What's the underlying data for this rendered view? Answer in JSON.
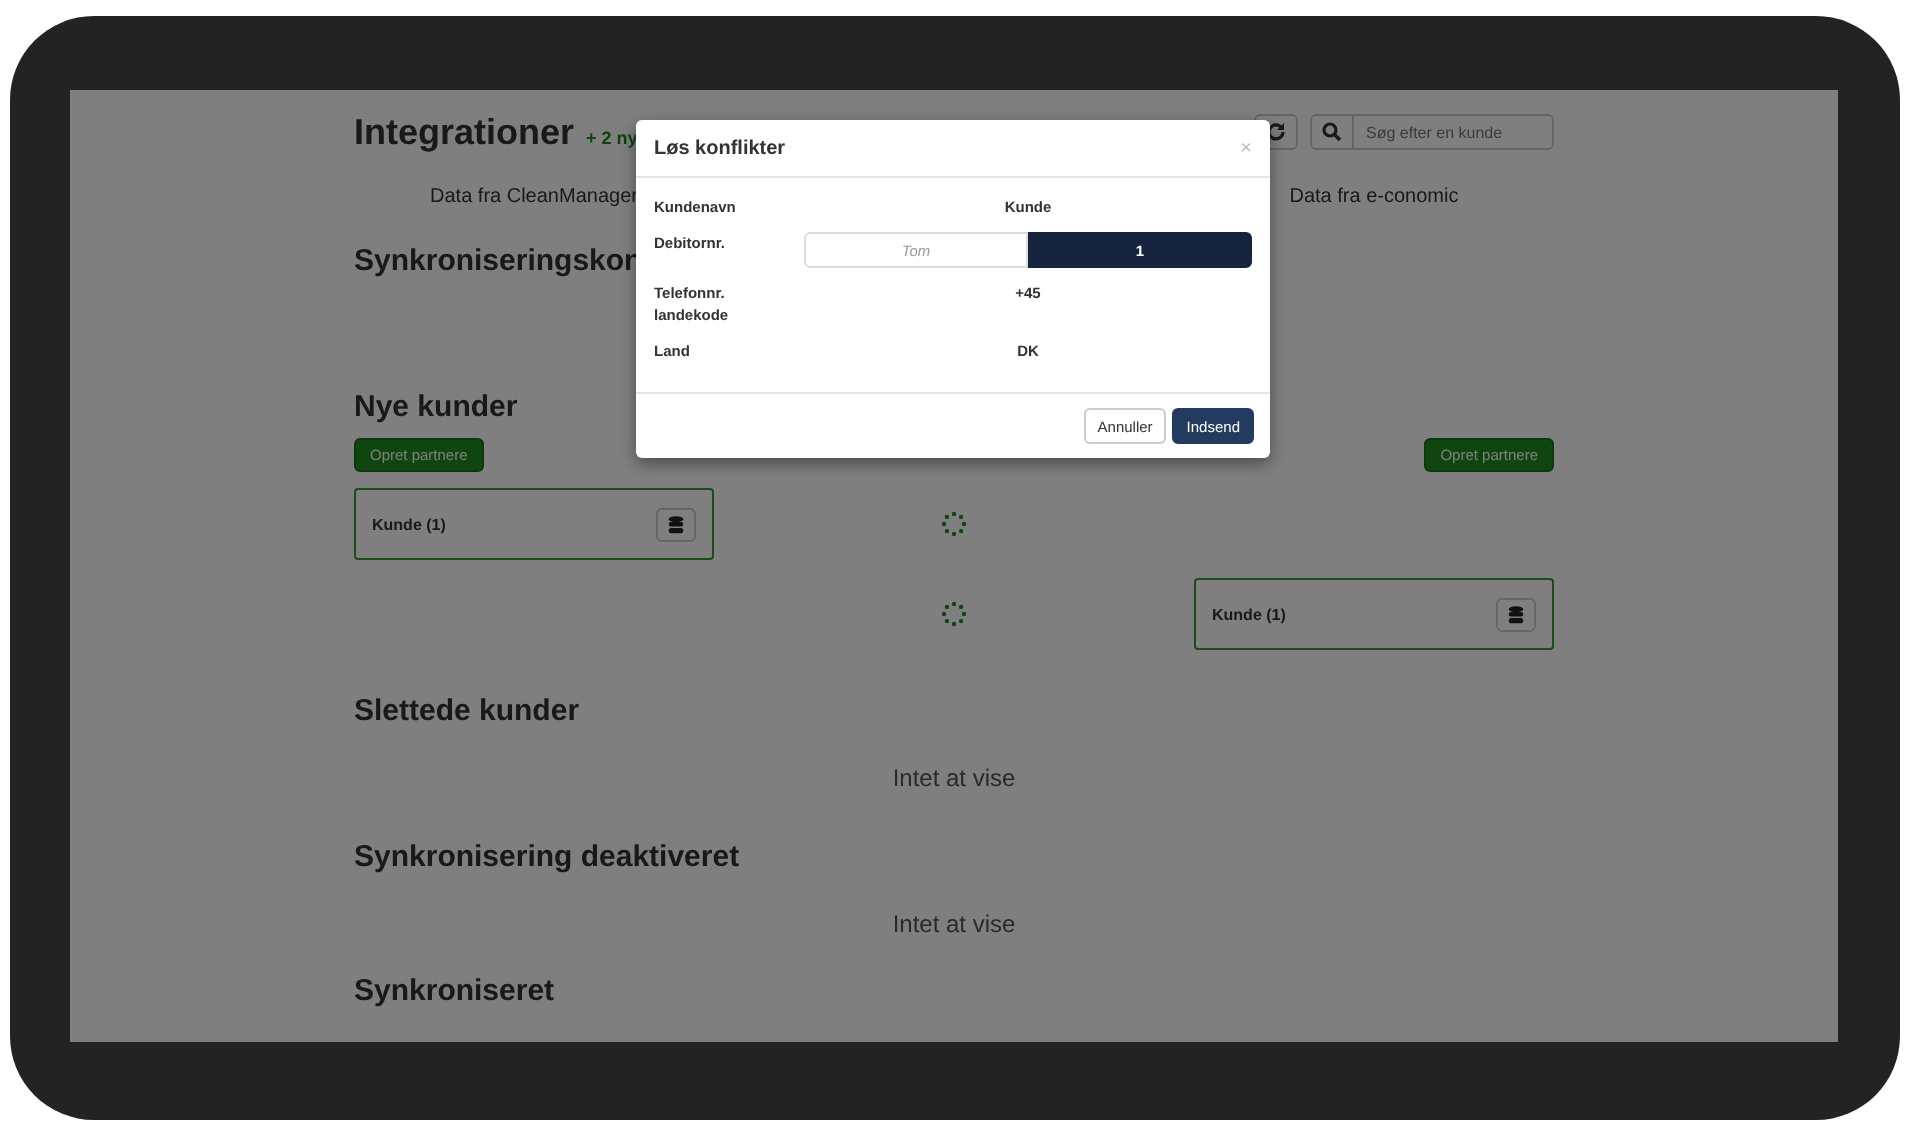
{
  "page": {
    "title": "Integrationer",
    "badge": "+ 2 ny",
    "search": {
      "placeholder": "Søg efter en kunde"
    },
    "columns": [
      "Data fra CleanManager",
      "Data fra e-conomic"
    ],
    "sections": [
      {
        "kind": "heading",
        "title": "Synkroniseringskon"
      },
      {
        "kind": "new",
        "title": "Nye kunder",
        "buttons": [
          "Opret partnere",
          "Opret partnere"
        ],
        "rows": [
          {
            "left": "Kunde (1)"
          },
          {
            "right": "Kunde (1)"
          }
        ]
      },
      {
        "kind": "empty",
        "title": "Slettede kunder",
        "message": "Intet at vise"
      },
      {
        "kind": "empty",
        "title": "Synkronisering deaktiveret",
        "message": "Intet at vise"
      },
      {
        "kind": "heading",
        "title": "Synkroniseret"
      }
    ]
  },
  "modal": {
    "title": "Løs konflikter",
    "close": "×",
    "rows": [
      {
        "kind": "text",
        "label": "Kundenavn",
        "value": "Kunde"
      },
      {
        "kind": "choice",
        "label": "Debitornr.",
        "options": [
          {
            "label": "Tom",
            "selected": false
          },
          {
            "label": "1",
            "selected": true
          }
        ]
      },
      {
        "kind": "text",
        "label": "Telefonnr. landekode",
        "value": "+45"
      },
      {
        "kind": "text",
        "label": "Land",
        "value": "DK"
      }
    ],
    "buttons": [
      {
        "label": "Annuller",
        "kind": "secondary"
      },
      {
        "label": "Indsend",
        "kind": "primary"
      }
    ]
  }
}
